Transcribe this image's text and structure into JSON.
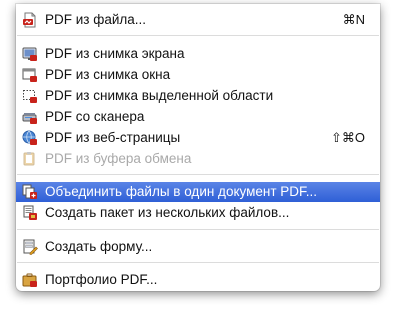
{
  "menu": {
    "items": [
      {
        "label": "PDF из файла...",
        "shortcut": "⌘N",
        "icon": "pdf-file-icon"
      },
      {
        "label": "PDF из снимка экрана",
        "shortcut": "",
        "icon": "screen-capture-icon"
      },
      {
        "label": "PDF из снимка окна",
        "shortcut": "",
        "icon": "window-capture-icon"
      },
      {
        "label": "PDF из снимка выделенной области",
        "shortcut": "",
        "icon": "selection-capture-icon"
      },
      {
        "label": "PDF со сканера",
        "shortcut": "",
        "icon": "scanner-icon"
      },
      {
        "label": "PDF из веб-страницы",
        "shortcut": "⇧⌘O",
        "icon": "web-page-icon"
      },
      {
        "label": "PDF из буфера обмена",
        "shortcut": "",
        "icon": "clipboard-icon",
        "disabled": true
      },
      {
        "label": "Объединить файлы в один документ PDF...",
        "shortcut": "",
        "icon": "combine-files-icon",
        "selected": true
      },
      {
        "label": "Создать пакет из нескольких файлов...",
        "shortcut": "",
        "icon": "batch-files-icon"
      },
      {
        "label": "Создать форму...",
        "shortcut": "",
        "icon": "form-icon"
      },
      {
        "label": "Портфолио PDF...",
        "shortcut": "",
        "icon": "portfolio-icon"
      }
    ],
    "colors": {
      "highlight": "#3a6ad9",
      "disabled_text": "#a9a9a9",
      "pdf_red": "#c8231b"
    }
  }
}
